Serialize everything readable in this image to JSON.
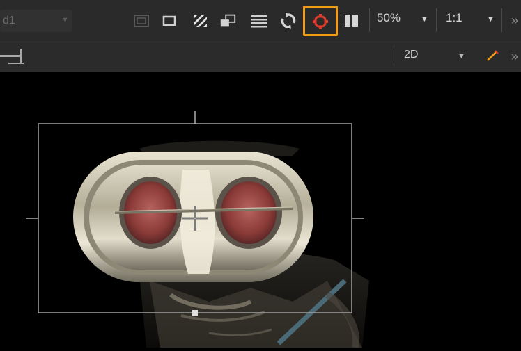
{
  "toolbar": {
    "layer_dropdown": "d1",
    "zoom_value": "50%",
    "ratio_value": "1:1"
  },
  "subtoolbar": {
    "view_mode": "2D"
  },
  "colors": {
    "highlight": "#f39c12",
    "active_icon": "#e23a2a",
    "toolbar_bg": "#2a2a2a"
  }
}
